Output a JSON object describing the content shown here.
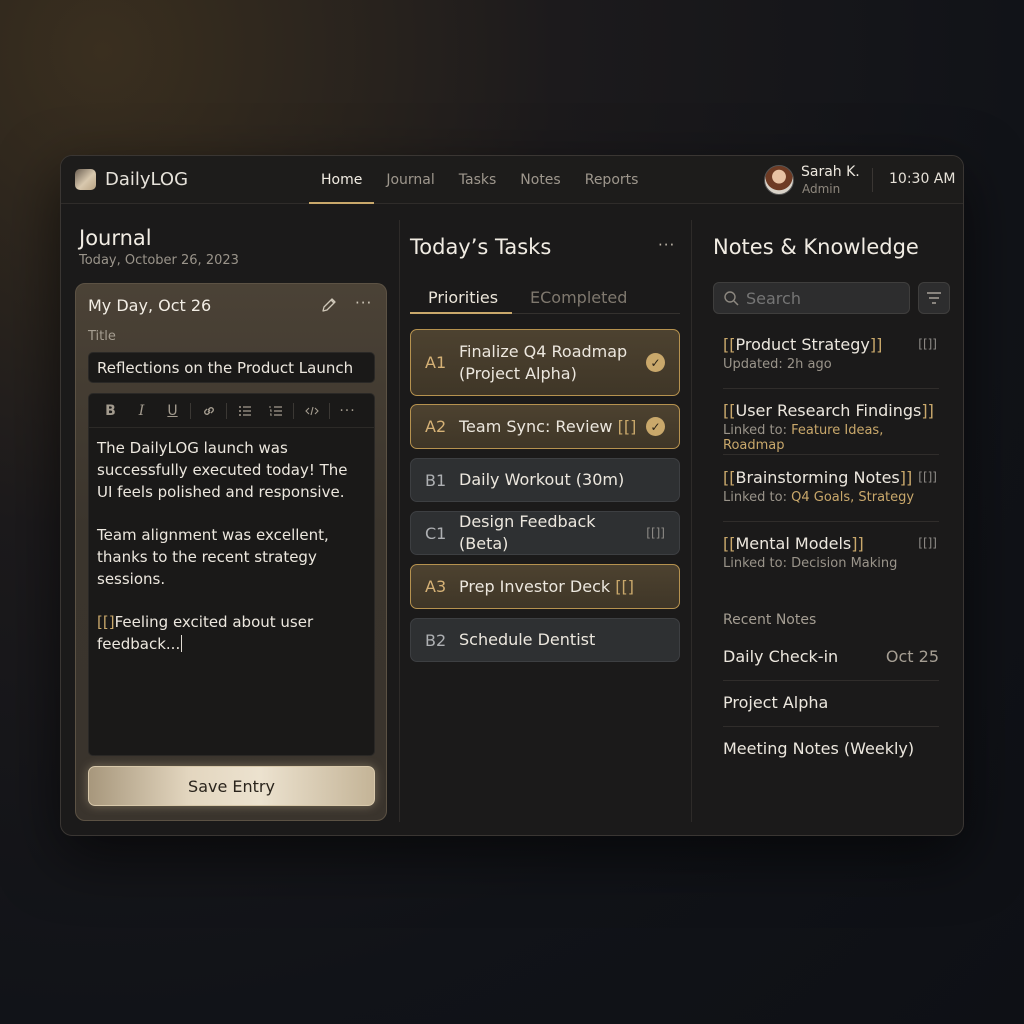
{
  "app": {
    "name": "DailyLOG"
  },
  "nav": {
    "items": [
      "Home",
      "Journal",
      "Tasks",
      "Notes",
      "Reports"
    ],
    "active": "Home"
  },
  "user": {
    "name": "Sarah K.",
    "role": "Admin"
  },
  "clock": "10:30 AM",
  "journal": {
    "heading": "Journal",
    "date": "Today, October 26, 2023",
    "entry": {
      "title": "My Day, Oct 26",
      "title_label": "Title",
      "title_value": "Reflections on the Product Launch",
      "body": [
        "The DailyLOG launch was successfully executed today! The UI feels polished and responsive.",
        "Team alignment was excellent, thanks to the recent strategy sessions.",
        "Feeling excited about user feedback..."
      ],
      "body_prefix": "[[]",
      "save_label": "Save Entry"
    },
    "toolbar": [
      "B",
      "I",
      "U",
      "link",
      "bulleted-list",
      "numbered-list",
      "code",
      "more"
    ]
  },
  "tasks": {
    "heading": "Today’s Tasks",
    "tabs": [
      "Priorities",
      "ECompleted"
    ],
    "active_tab": "Priorities",
    "items": [
      {
        "code": "A1",
        "label_line1": "Finalize Q4 Roadmap",
        "label_line2": "(Project Alpha)",
        "highlight": true,
        "done": true
      },
      {
        "code": "A2",
        "label": "Team Sync: Review",
        "suffix": "[[]",
        "highlight": true,
        "done": true
      },
      {
        "code": "B1",
        "label": "Daily Workout (30m)",
        "highlight": false,
        "done": false
      },
      {
        "code": "C1",
        "label": "Design Feedback (Beta)",
        "tag": "[[]]",
        "highlight": false,
        "done": false
      },
      {
        "code": "A3",
        "label": "Prep Investor Deck",
        "suffix": "[[]",
        "highlight": true,
        "done": false
      },
      {
        "code": "B2",
        "label": "Schedule Dentist",
        "highlight": false,
        "done": false
      }
    ]
  },
  "notes": {
    "heading": "Notes & Knowledge",
    "search_placeholder": "Search",
    "items": [
      {
        "open": "[[",
        "title": "Product Strategy",
        "close": "]]",
        "sub": "Updated: 2h ago",
        "tag": "[[]]"
      },
      {
        "open": "[[",
        "title": "User Research Findings",
        "close": "]]",
        "sub_prefix": "Linked to: ",
        "links": "Feature Ideas, Roadmap"
      },
      {
        "open": "[[",
        "title": "Brainstorming Notes",
        "close": "]]",
        "sub_prefix": "Linked to: ",
        "links": "Q4 Goals, Strategy",
        "tag": "[[]]"
      },
      {
        "open": "[[",
        "title": "Mental Models",
        "close": "]]",
        "sub": "Linked to: Decision Making",
        "tag": "[[]]"
      }
    ],
    "recent_heading": "Recent Notes",
    "recent": [
      {
        "title": "Daily Check-in",
        "date": "Oct 25"
      },
      {
        "title": "Project Alpha"
      },
      {
        "title": "Meeting Notes (Weekly)"
      }
    ]
  },
  "colors": {
    "accent": "#c9a86b",
    "background": "#1b1a1a",
    "panel": "#3b352d"
  }
}
